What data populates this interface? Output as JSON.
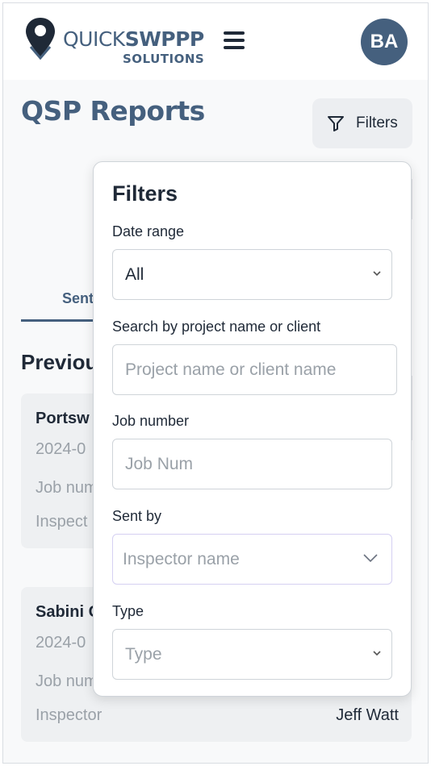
{
  "header": {
    "logo_top_thin": "QUICK",
    "logo_top_bold": "SWPPP",
    "logo_bottom": "SOLUTIONS",
    "avatar_initials": "BA"
  },
  "page": {
    "title": "QSP Reports",
    "filters_button_label": "Filters"
  },
  "background": {
    "tab_label": "Sent",
    "section_heading": "Previous",
    "cards": [
      {
        "title": "Portsw",
        "date": "2024-0",
        "job_label": "Job num",
        "inspector_label": "Inspect",
        "inspector_value": ""
      },
      {
        "title": "Sabini C",
        "date": "2024-0",
        "job_label": "Job num",
        "inspector_label": "Inspector",
        "inspector_value": "Jeff Watt"
      }
    ]
  },
  "filters": {
    "title": "Filters",
    "date_range": {
      "label": "Date range",
      "value": "All"
    },
    "search": {
      "label": "Search by project name or client",
      "placeholder": "Project name or client name"
    },
    "job_number": {
      "label": "Job number",
      "placeholder": "Job Num"
    },
    "sent_by": {
      "label": "Sent by",
      "placeholder": "Inspector name"
    },
    "type": {
      "label": "Type",
      "placeholder": "Type"
    }
  },
  "colors": {
    "brand": "#45607e",
    "card_bg": "#eef0f2",
    "placeholder": "#9aa1a8"
  }
}
